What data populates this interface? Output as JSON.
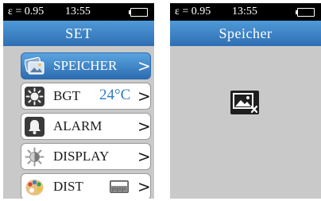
{
  "screens": {
    "left": {
      "status": {
        "emissivity": "ε = 0.95",
        "time": "13:55",
        "battery_icon": "battery-icon",
        "battery_color": "#22b14c"
      },
      "title": "SET",
      "menu": [
        {
          "label": "SPEICHER",
          "value": "",
          "icon": "gallery-icon",
          "selected": true
        },
        {
          "label": "BGT",
          "value": "24°C",
          "icon": "sun-icon",
          "selected": false
        },
        {
          "label": "ALARM",
          "value": "",
          "icon": "bell-icon",
          "selected": false
        },
        {
          "label": "DISPLAY",
          "value": "",
          "icon": "brightness-icon",
          "selected": false
        },
        {
          "label": "DIST",
          "value": "",
          "icon": "palette-icon",
          "selected": false
        }
      ],
      "chevron": ">"
    },
    "right": {
      "status": {
        "emissivity": "ε = 0.95",
        "time": "13:55",
        "battery_icon": "battery-icon",
        "battery_color": "#22b14c"
      },
      "title": "Speicher",
      "empty_icon": "no-image-icon"
    }
  },
  "colors": {
    "accent": "#3b82c8",
    "value_text": "#2e7bc4",
    "background": "#c9c9c9"
  }
}
